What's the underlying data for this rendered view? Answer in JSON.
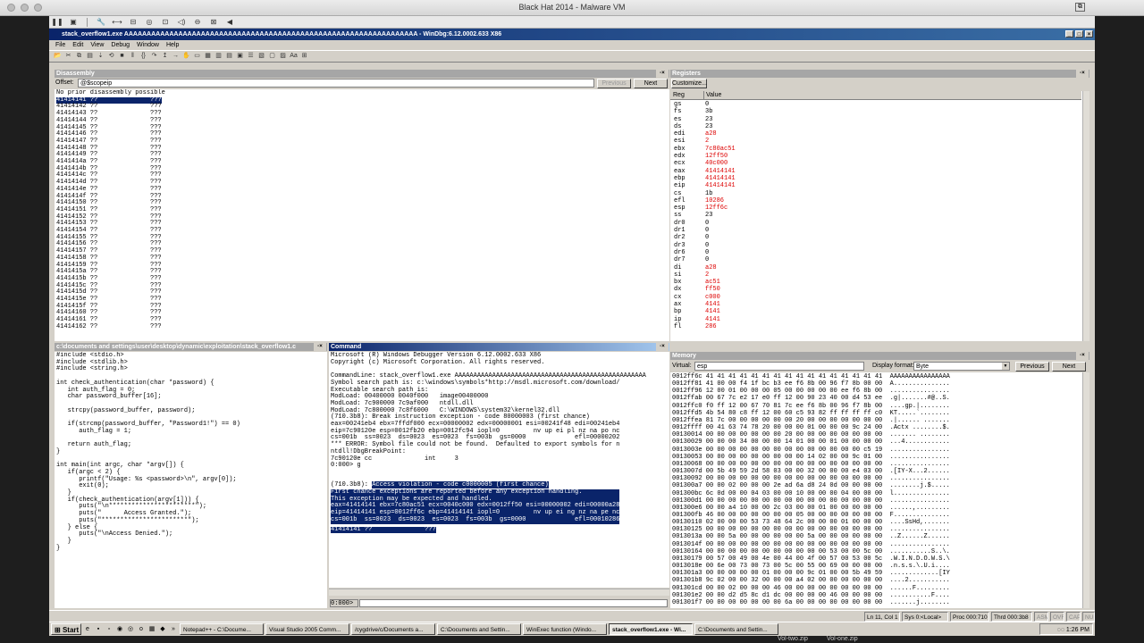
{
  "mac": {
    "title": "Black Hat 2014 - Malware VM"
  },
  "vm_toolbar": {
    "icons": [
      "pause-icon",
      "snapshot-icon",
      "settings-icon",
      "network-icon",
      "usb-icon",
      "cd-icon",
      "lock-icon",
      "sound-icon",
      "screen-icon",
      "scale-icon",
      "back-icon"
    ]
  },
  "window": {
    "title": "stack_overflow1.exe AAAAAAAAAAAAAAAAAAAAAAAAAAAAAAAAAAAAAAAAAAAAAAAAAAAAAAAAAAAAAAAAA - WinDbg:6.12.0002.633 X86"
  },
  "menu": [
    "File",
    "Edit",
    "View",
    "Debug",
    "Window",
    "Help"
  ],
  "disasm": {
    "title": "Disassembly",
    "offset_label": "Offset:",
    "offset_value": "@$scopeip",
    "prev": "Previous",
    "next": "Next",
    "text": "No prior disassembly possible\n41414142 ??              ???\n41414143 ??              ???\n41414144 ??              ???\n41414145 ??              ???\n41414146 ??              ???\n41414147 ??              ???\n41414148 ??              ???\n41414149 ??              ???\n4141414a ??              ???\n4141414b ??              ???\n4141414c ??              ???\n4141414d ??              ???\n4141414e ??              ???\n4141414f ??              ???\n41414150 ??              ???\n41414151 ??              ???\n41414152 ??              ???\n41414153 ??              ???\n41414154 ??              ???\n41414155 ??              ???\n41414156 ??              ???\n41414157 ??              ???\n41414158 ??              ???\n41414159 ??              ???\n4141415a ??              ???\n4141415b ??              ???\n4141415c ??              ???\n4141415d ??              ???\n4141415e ??              ???\n4141415f ??              ???\n41414160 ??              ???\n41414161 ??              ???\n41414162 ??              ???",
    "selected": "41414141 ??              ???"
  },
  "registers": {
    "title": "Registers",
    "customize": "Customize...",
    "col_reg": "Reg",
    "col_value": "Value",
    "rows": [
      [
        "gs",
        "0",
        false
      ],
      [
        "fs",
        "3b",
        false
      ],
      [
        "es",
        "23",
        false
      ],
      [
        "ds",
        "23",
        false
      ],
      [
        "edi",
        "a28",
        true
      ],
      [
        "esi",
        "2",
        true
      ],
      [
        "ebx",
        "7c80ac51",
        true
      ],
      [
        "edx",
        "12ff50",
        true
      ],
      [
        "ecx",
        "40c000",
        true
      ],
      [
        "eax",
        "41414141",
        true
      ],
      [
        "ebp",
        "41414141",
        true
      ],
      [
        "eip",
        "41414141",
        true
      ],
      [
        "cs",
        "1b",
        false
      ],
      [
        "efl",
        "10286",
        true
      ],
      [
        "esp",
        "12ff6c",
        true
      ],
      [
        "ss",
        "23",
        false
      ],
      [
        "dr0",
        "0",
        false
      ],
      [
        "dr1",
        "0",
        false
      ],
      [
        "dr2",
        "0",
        false
      ],
      [
        "dr3",
        "0",
        false
      ],
      [
        "dr6",
        "0",
        false
      ],
      [
        "dr7",
        "0",
        false
      ],
      [
        "di",
        "a28",
        true
      ],
      [
        "si",
        "2",
        true
      ],
      [
        "bx",
        "ac51",
        true
      ],
      [
        "dx",
        "ff50",
        true
      ],
      [
        "cx",
        "c000",
        true
      ],
      [
        "ax",
        "4141",
        true
      ],
      [
        "bp",
        "4141",
        true
      ],
      [
        "ip",
        "4141",
        true
      ],
      [
        "fl",
        "286",
        true
      ]
    ]
  },
  "source": {
    "title": "c:\\documents and settings\\user\\desktop\\dynamic\\exploitation\\stack_overflow1.c",
    "text": "#include <stdio.h>\n#include <stdlib.h>\n#include <string.h>\n\nint check_authentication(char *password) {\n   int auth_flag = 0;\n   char password_buffer[16];\n\n   strcpy(password_buffer, password);\n\n   if(strcmp(password_buffer, \"Password1!\") == 0)\n      auth_flag = 1;\n\n   return auth_flag;\n}\n\nint main(int argc, char *argv[]) {\n   if(argc < 2) {\n      printf(\"Usage: %s <password>\\n\", argv[0]);\n      exit(0);\n   }\n   if(check_authentication(argv[1])) {\n      puts(\"\\n***********************\");\n      puts(\"      Access Granted.\");\n      puts(\"***********************\");\n   } else {\n      puts(\"\\nAccess Denied.\");\n   }\n}"
  },
  "command": {
    "title": "Command",
    "text": "Microsoft (R) Windows Debugger Version 6.12.0002.633 X86\nCopyright (c) Microsoft Corporation. All rights reserved.\n\nCommandLine: stack_overflow1.exe AAAAAAAAAAAAAAAAAAAAAAAAAAAAAAAAAAAAAAAAAAAAAAAAAAA\nSymbol search path is: c:\\windows\\symbols*http://msdl.microsoft.com/download/\nExecutable search path is:\nModLoad: 00400000 0040f000   image00400000\nModLoad: 7c900000 7c9af000   ntdll.dll\nModLoad: 7c800000 7c8f6000   C:\\WINDOWS\\system32\\kernel32.dll\n(710.3b8): Break instruction exception - code 80000003 (first chance)\neax=00241eb4 ebx=7ffdf000 ecx=00000002 edx=00000001 esi=00241f48 edi=00241eb4\neip=7c90120e esp=0012fb20 ebp=0012fc94 iopl=0         nv up ei pl nz na po nc\ncs=001b  ss=0023  ds=0023  es=0023  fs=003b  gs=0000             efl=00000202\n*** ERROR: Symbol file could not be found.  Defaulted to export symbols for n\nntdll!DbgBreakPoint:\n7c90120e cc              int     3\n0:000> g",
    "hl_prefix": "(710.3b8): ",
    "hl_lines": [
      "Access violation - code c0000005 (first chance)",
      "First chance exceptions are reported before any exception handling.",
      "This exception may be expected and handled.",
      "eax=41414141 ebx=7c80ac51 ecx=0040c000 edx=0012ff50 esi=00000002 edi=00000a28",
      "eip=41414141 esp=0012ff6c ebp=41414141 iopl=0         nv up ei ng nz na pe nc",
      "cs=001b  ss=0023  ds=0023  es=0023  fs=003b  gs=0000             efl=00010286",
      "41414141 ??              ???"
    ],
    "prompt": "0:000>"
  },
  "memory": {
    "title": "Memory",
    "virtual_label": "Virtual:",
    "virtual_value": "esp",
    "format_label": "Display format:",
    "format_value": "Byte",
    "prev": "Previous",
    "next": "Next",
    "text": "0012ff6c 41 41 41 41 41 41 41 41 41 41 41 41 41 41 41 41  AAAAAAAAAAAAAAAA\n0012ff81 41 00 00 f4 1f bc b3 ee f6 8b 00 96 f7 8b 00 00  A...............\n0012ff96 12 00 01 00 00 00 05 00 00 00 00 00 ee f6 8b 00  ................\n0012ffab 00 67 7c e2 17 e0 ff 12 00 90 23 40 00 d4 53 ee  .g|.......#@..S.\n0012ffc0 f0 ff 12 00 67 70 81 7c ee f6 8b 00 96 f7 8b 00  ....gp.|........\n0012ffd5 4b 54 80 c8 ff 12 00 60 c5 93 82 ff ff ff ff c0  KT.....`........\n0012ffea 81 7c 00 00 00 00 00 00 20 00 00 00 00 00 00 00  .|...... .......\n0012ffff 00 41 63 74 78 20 00 00 00 01 00 00 00 9c 24 00  .Actx ........$.\n00130014 00 00 00 00 00 00 00 20 00 00 00 00 00 00 00 00  ....... ........\n00130029 00 00 00 34 00 00 00 14 01 00 00 01 00 00 00 00  ...4............\n0013003e 00 00 00 00 00 00 00 00 00 00 00 00 00 00 c5 19  ................\n00130053 00 00 00 00 00 00 00 00 00 14 02 00 00 9c 01 00  ................\n00130068 00 00 00 00 00 00 00 00 00 00 00 00 00 00 00 00  ................\n0013007d 00 5b 49 59 2d 58 03 00 00 32 00 00 00 e4 03 00  .[IY-X...2......\n00130092 00 00 00 00 00 00 00 00 00 00 00 00 00 00 00 00  ................\n001300a7 00 00 02 00 00 00 2e ad 6a d8 24 0d 00 00 00 00  ........j.$.....\n001300bc 6c 0d 00 00 04 03 00 00 10 00 00 00 04 00 00 00  l...............\n001300d1 00 00 00 00 00 00 00 00 00 00 00 00 00 00 00 00  ................\n001300e6 00 00 a4 10 00 00 2c 03 00 00 01 00 00 00 00 00  ......,.........\n001300fb 46 00 00 00 00 00 00 00 05 00 00 00 00 00 00 00  F...............\n00130110 02 00 00 00 53 73 48 64 2c 00 00 00 01 00 00 00  ....SsHd,.......\n00130125 00 00 00 00 00 00 00 00 00 00 00 00 00 00 00 00  ................\n0013013a 00 00 5a 00 00 00 00 00 00 5a 00 00 00 00 00 00  ..Z......Z......\n0013014f 00 00 00 00 00 00 00 00 00 00 00 00 00 00 00 00  ................\n00130164 00 00 00 00 00 00 00 00 00 00 00 53 00 00 5c 00  ...........S..\\.\n00130179 00 57 00 49 00 4e 00 44 00 4f 00 57 00 53 00 5c  .W.I.N.D.O.W.S.\\\n0013018e 00 6e 00 73 00 73 00 5c 00 55 00 69 00 00 00 00  .n.s.s.\\.U.i....\n001301a3 00 00 00 00 00 01 00 00 00 9c 01 00 00 5b 49 59  .............[IY\n001301b8 9c 02 00 00 32 00 00 00 a4 02 00 00 00 00 00 00  ....2...........\n001301cd 00 00 02 00 00 00 46 00 00 00 00 00 00 00 00 00  ......F.........\n001301e2 00 00 d2 d5 8c d1 dc 00 00 00 00 46 00 00 00 00  ...........F....\n001301f7 00 00 00 00 00 00 00 6a 00 00 00 00 00 00 00 00  .......j........"
  },
  "status": [
    "Ln 11, Col 1",
    "Sys 0:<Local>",
    "Proc 000:710",
    "Thrd 000:3b8",
    "ASM",
    "OVR",
    "CAPS",
    "NUM"
  ],
  "taskbar": {
    "start": "Start",
    "tasks": [
      "Notepad++ - C:\\Docume...",
      "Visual Studio 2005 Comm...",
      "/cygdrive/c/Documents a...",
      "C:\\Documents and Settin...",
      "WinExec function (Windo...",
      "stack_overflow1.exe - Wi...",
      "C:\\Documents and Settin..."
    ],
    "active_index": 5,
    "clock": "1:26 PM"
  },
  "below": [
    "Vol-two.zip",
    "Vol-one.zip"
  ]
}
